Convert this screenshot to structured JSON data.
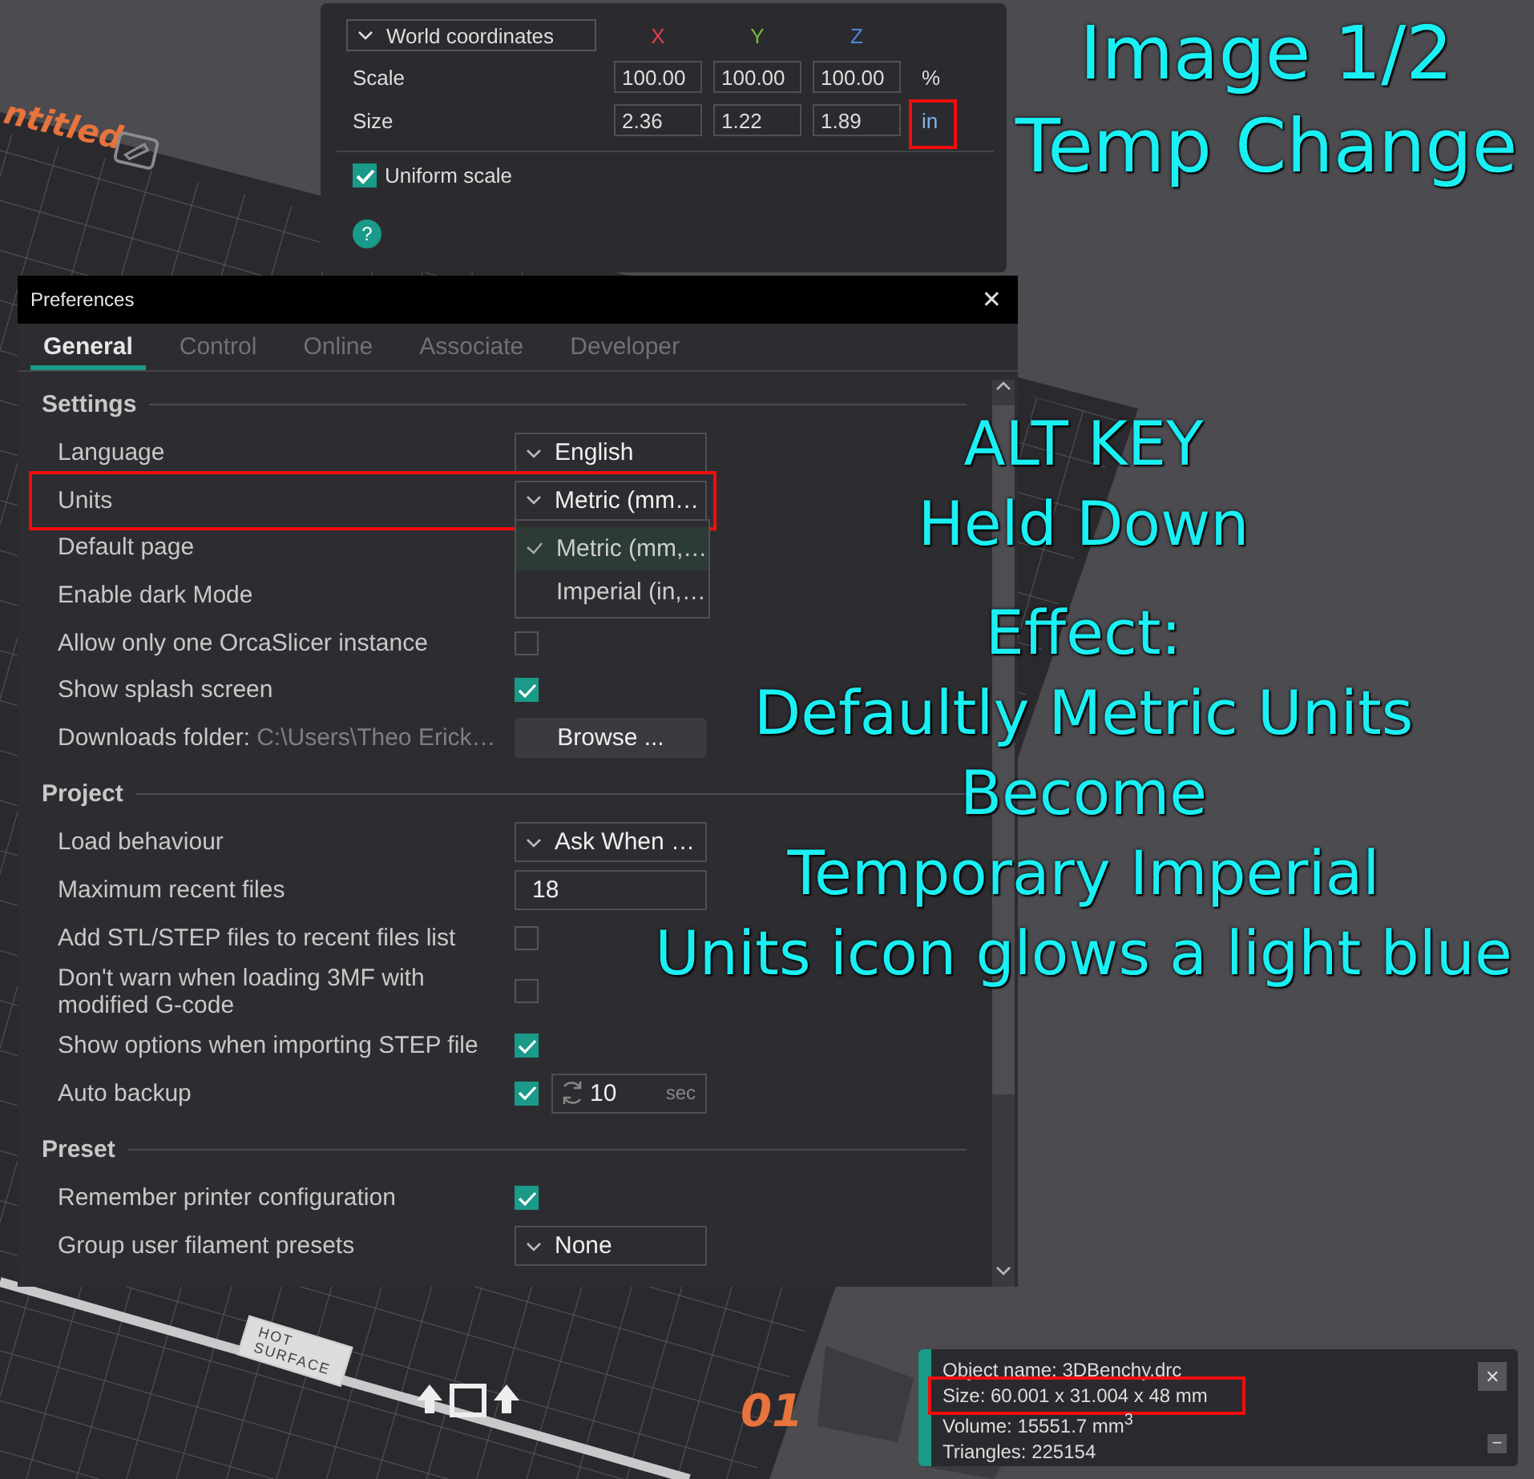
{
  "viewport": {
    "project_name": "ntitled",
    "plate_number": "01",
    "bed_label": [
      "HOT",
      "SURFACE"
    ]
  },
  "transform_panel": {
    "coordinate_system": "World coordinates",
    "axes": [
      {
        "label": "X",
        "color": "#e0424f"
      },
      {
        "label": "Y",
        "color": "#6fbf3a"
      },
      {
        "label": "Z",
        "color": "#4a86d8"
      }
    ],
    "rows": [
      {
        "label": "Scale",
        "values": [
          "100.00",
          "100.00",
          "100.00"
        ],
        "unit": "%",
        "highlighted": false
      },
      {
        "label": "Size",
        "values": [
          "2.36",
          "1.22",
          "1.89"
        ],
        "unit": "in",
        "highlighted": true
      }
    ],
    "uniform_scale": {
      "label": "Uniform scale",
      "checked": true
    },
    "help": "?"
  },
  "preferences": {
    "title": "Preferences",
    "close": "✕",
    "tabs": [
      {
        "label": "General",
        "selected": true
      },
      {
        "label": "Control",
        "selected": false
      },
      {
        "label": "Online",
        "selected": false
      },
      {
        "label": "Associate",
        "selected": false
      },
      {
        "label": "Developer",
        "selected": false
      }
    ],
    "sections": [
      {
        "title": "Settings",
        "rows": [
          {
            "kind": "dropdown",
            "label": "Language",
            "value": "English"
          },
          {
            "kind": "dropdown",
            "label": "Units",
            "value": "Metric (mm…",
            "expanded": true,
            "highlighted": true,
            "options": [
              {
                "label": "Metric (mm,…",
                "selected": true
              },
              {
                "label": "Imperial (in,…",
                "selected": false
              }
            ]
          },
          {
            "kind": "label",
            "label": "Default page"
          },
          {
            "kind": "label",
            "label": "Enable dark Mode"
          },
          {
            "kind": "checkbox",
            "label": "Allow only one OrcaSlicer instance",
            "checked": false
          },
          {
            "kind": "checkbox",
            "label": "Show splash screen",
            "checked": true
          },
          {
            "kind": "folder",
            "label": "Downloads folder:",
            "path": "C:\\Users\\Theo Erick…",
            "button": "Browse ..."
          }
        ]
      },
      {
        "title": "Project",
        "rows": [
          {
            "kind": "dropdown",
            "label": "Load behaviour",
            "value": "Ask When …"
          },
          {
            "kind": "text",
            "label": "Maximum recent files",
            "value": "18"
          },
          {
            "kind": "checkbox",
            "label": "Add STL/STEP files to recent files list",
            "checked": false
          },
          {
            "kind": "checkbox",
            "label": "Don't warn when loading 3MF with modified G-code",
            "checked": false
          },
          {
            "kind": "checkbox",
            "label": "Show options when importing STEP file",
            "checked": true
          },
          {
            "kind": "spinner",
            "label": "Auto backup",
            "checked": true,
            "value": "10",
            "unit": "sec"
          }
        ]
      },
      {
        "title": "Preset",
        "rows": [
          {
            "kind": "checkbox",
            "label": "Remember printer configuration",
            "checked": true
          },
          {
            "kind": "dropdown",
            "label": "Group user filament presets",
            "value": "None"
          }
        ]
      }
    ]
  },
  "object_info": {
    "lines": [
      {
        "text": "Object name: 3DBenchy.drc"
      },
      {
        "text": "Size: 60.001 x 31.004 x 48 mm",
        "highlighted": true
      },
      {
        "text": "Volume: 15551.7 mm$^{3}$"
      },
      {
        "text": "Triangles: 225154"
      }
    ],
    "close": "✕",
    "minimize": "−"
  },
  "annotation": {
    "title_lines": [
      "Image 1/2",
      "Temp Change"
    ],
    "note_groups": [
      [
        "ALT KEY",
        "Held Down"
      ],
      [
        "Effect:",
        "Defaultly Metric Units",
        "Become",
        "Temporary Imperial",
        "Units icon glows a light blue"
      ]
    ]
  }
}
